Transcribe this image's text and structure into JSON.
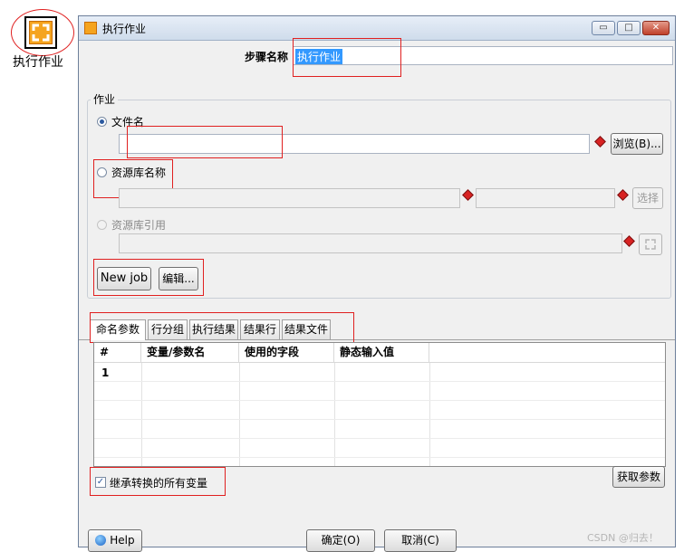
{
  "desktop": {
    "icon_label": "执行作业"
  },
  "window": {
    "title": "执行作业",
    "min_label": "▭",
    "max_label": "□",
    "close_label": "✕"
  },
  "step": {
    "label": "步骤名称",
    "value": "执行作业"
  },
  "job_group": {
    "title": "作业",
    "filename_label": "文件名",
    "filename_value": "",
    "browse_label": "浏览(B)...",
    "repo_name_label": "资源库名称",
    "select_label": "选择",
    "repo_ref_label": "资源库引用",
    "new_job_label": "New job",
    "edit_label": "编辑..."
  },
  "tabs": [
    {
      "label": "命名参数"
    },
    {
      "label": "行分组"
    },
    {
      "label": "执行结果"
    },
    {
      "label": "结果行"
    },
    {
      "label": "结果文件"
    }
  ],
  "table": {
    "columns": [
      "#",
      "变量/参数名",
      "使用的字段",
      "静态输入值"
    ],
    "rows": [
      [
        "1",
        "",
        "",
        ""
      ]
    ]
  },
  "inherit": {
    "label": "继承转换的所有变量",
    "checked": true
  },
  "get_params_label": "获取参数",
  "footer": {
    "help_label": "Help",
    "ok_label": "确定(O)",
    "cancel_label": "取消(C)"
  },
  "watermark": "CSDN @归去！"
}
